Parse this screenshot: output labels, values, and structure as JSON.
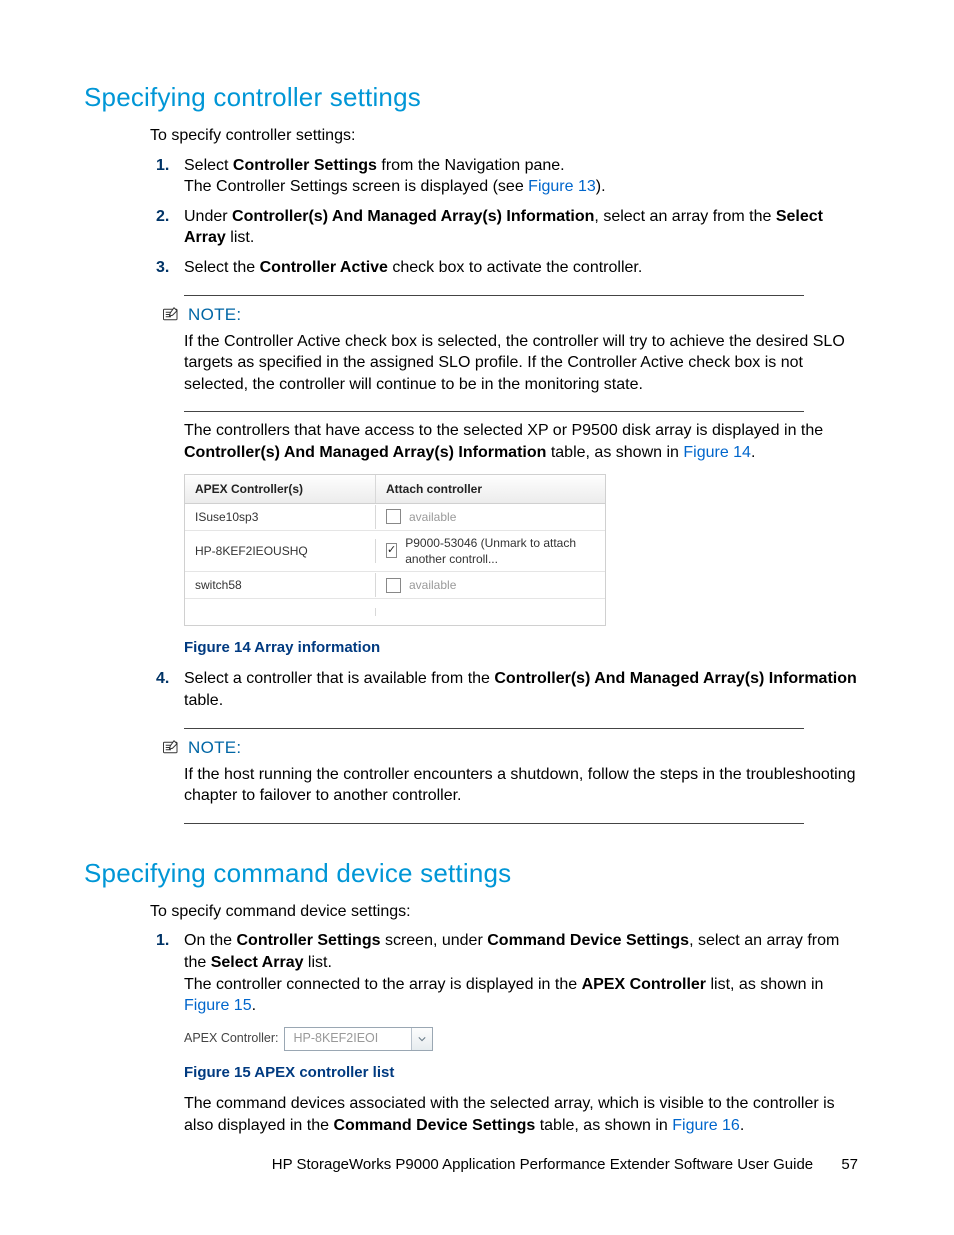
{
  "section1": {
    "heading": "Specifying controller settings",
    "intro": "To specify controller settings:",
    "steps": {
      "s1a": "Select ",
      "s1b": "Controller Settings",
      "s1c": " from the Navigation pane.",
      "s1d": "The Controller Settings screen is displayed (see ",
      "s1e": "Figure 13",
      "s1f": ").",
      "s2a": "Under ",
      "s2b": "Controller(s) And Managed Array(s) Information",
      "s2c": ", select an array from the ",
      "s2d": "Select Array",
      "s2e": " list.",
      "s3a": "Select the ",
      "s3b": "Controller Active",
      "s3c": " check box to activate the controller."
    },
    "noteLabel": "NOTE:",
    "note1": "If the Controller Active check box is selected, the controller will try to achieve the desired SLO targets as specified in the assigned SLO profile. If the Controller Active check box is not selected, the controller will continue to be in the monitoring state.",
    "afterNote_a": "The controllers that have access to the selected XP or P9500 disk array is displayed in the ",
    "afterNote_b": "Controller(s) And Managed Array(s) Information",
    "afterNote_c": " table, as shown in ",
    "afterNote_d": "Figure 14",
    "afterNote_e": ".",
    "fig14": {
      "col1": "APEX Controller(s)",
      "col2": "Attach controller",
      "rows": [
        {
          "name": "ISuse10sp3",
          "checked": false,
          "attach": "available"
        },
        {
          "name": "HP-8KEF2IEOUSHQ",
          "checked": true,
          "attach": "P9000-53046 (Unmark to attach another controll..."
        },
        {
          "name": "switch58",
          "checked": false,
          "attach": "available"
        }
      ],
      "caption": "Figure 14 Array information"
    },
    "step4_a": "Select a controller that is available from the ",
    "step4_b": "Controller(s) And Managed Array(s) Information",
    "step4_c": " table.",
    "note2": "If the host running the controller encounters a shutdown, follow the steps in the troubleshooting chapter to failover to another controller."
  },
  "section2": {
    "heading": "Specifying command device settings",
    "intro": "To specify command device settings:",
    "s1a": "On the ",
    "s1b": "Controller Settings",
    "s1c": " screen, under ",
    "s1d": "Command Device Settings",
    "s1e": ", select an array from the ",
    "s1f": "Select Array",
    "s1g": " list.",
    "s1h": "The controller connected to the array is displayed in the ",
    "s1i": "APEX Controller",
    "s1j": " list, as shown in ",
    "s1k": "Figure 15",
    "s1l": ".",
    "fig15": {
      "label": "APEX Controller:",
      "value": "HP-8KEF2IEOI",
      "caption": "Figure 15 APEX controller list"
    },
    "after_a": "The command devices associated with the selected array, which is visible to the controller is also displayed in the ",
    "after_b": "Command Device Settings",
    "after_c": " table, as shown in ",
    "after_d": "Figure 16",
    "after_e": "."
  },
  "footer": {
    "title": "HP StorageWorks P9000 Application Performance Extender Software User Guide",
    "page": "57"
  }
}
